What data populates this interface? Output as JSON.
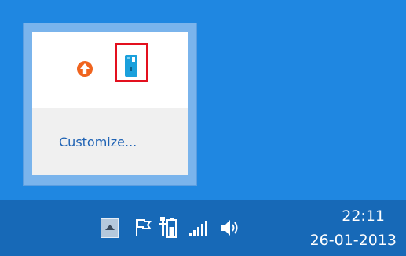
{
  "flyout": {
    "customize_label": "Customize...",
    "icons": [
      {
        "name": "upload-arrow-icon",
        "color": "#f0641e"
      },
      {
        "name": "usb-device-icon",
        "color": "#1aa0dc"
      }
    ],
    "highlight_color": "#e3101e"
  },
  "taskbar": {
    "show_hidden_icon": "chevron-up-icon",
    "tray_icons": [
      "action-center-flag-icon",
      "battery-icon",
      "network-signal-icon",
      "volume-icon"
    ],
    "clock": {
      "time": "22:11",
      "date": "26-01-2013"
    }
  },
  "colors": {
    "desktop": "#1f87e1",
    "taskbar": "#1769b7",
    "link": "#1e62b4"
  }
}
